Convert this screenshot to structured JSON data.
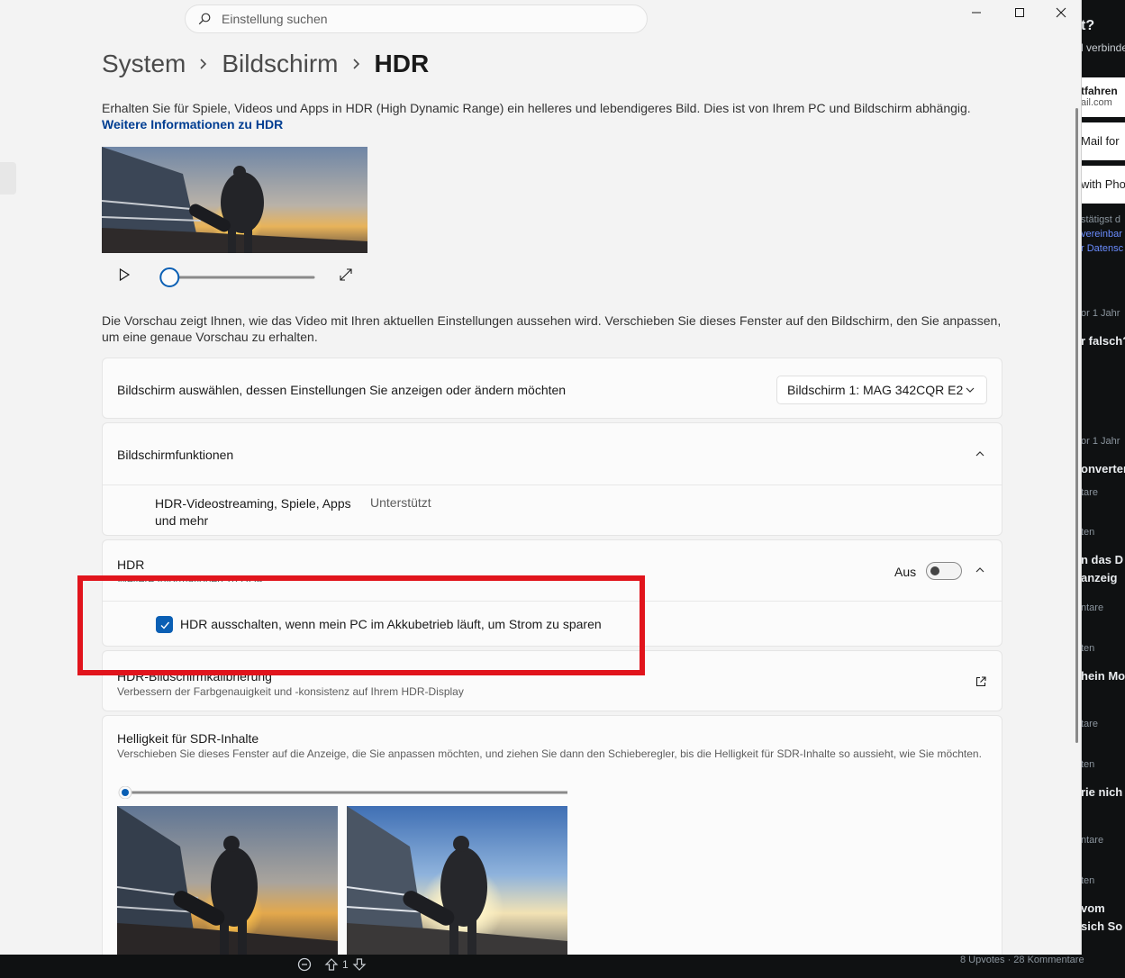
{
  "settings": {
    "search": {
      "placeholder": "Einstellung suchen"
    },
    "breadcrumb": {
      "items": [
        "System",
        "Bildschirm"
      ],
      "current": "HDR"
    },
    "intro": {
      "text": "Erhalten Sie für Spiele, Videos und Apps in HDR (High Dynamic Range) ein helleres und lebendigeres Bild. Dies ist von Ihrem PC und Bildschirm abhängig. ",
      "link": "Weitere Informationen zu HDR"
    },
    "preview_note": "Die Vorschau zeigt Ihnen, wie das Video mit Ihren aktuellen Einstellungen aussehen wird. Verschieben Sie dieses Fenster auf den Bildschirm, den Sie anpassen, um eine genaue Vorschau zu erhalten.",
    "player": {
      "progress": 0.02
    },
    "display_select": {
      "label": "Bildschirm auswählen, dessen Einstellungen Sie anzeigen oder ändern möchten",
      "value": "Bildschirm 1: MAG 342CQR E2"
    },
    "capabilities": {
      "title": "Bildschirmfunktionen",
      "feature": "HDR-Videostreaming, Spiele, Apps und mehr",
      "status": "Unterstützt"
    },
    "hdr": {
      "title": "HDR",
      "hidden_link": "Weitere Informationen zu HDR",
      "toggle_label": "Aus",
      "toggle_on": false,
      "battery_option": "HDR ausschalten, wenn mein PC im Akkubetrieb läuft, um Strom zu sparen",
      "battery_checked": true
    },
    "calibration": {
      "title": "HDR-Bildschirmkalibrierung",
      "subtitle": "Verbessern der Farbgenauigkeit und -konsistenz auf Ihrem HDR-Display"
    },
    "sdr": {
      "title": "Helligkeit für SDR-Inhalte",
      "subtitle": "Verschieben Sie dieses Fenster auf die Anzeige, die Sie anpassen möchten, und ziehen Sie dann den Schieberegler, bis die Helligkeit für SDR-Inhalte so aussieht, wie Sie möchten.",
      "slider_value": 0.0
    }
  },
  "background_page": {
    "fragments": [
      "t?",
      "l verbinde",
      "tfahren",
      "ail.com",
      "Mail for",
      "with Pho",
      "stätigst d",
      "vereinbar",
      "r Datensc",
      "or 1 Jahr",
      "r falsch?",
      "or 1 Jahr",
      "onverter",
      "tare",
      "ten",
      "n das D",
      "anzeig",
      "ntare",
      "ten",
      "hein Mo",
      "tare",
      "ten",
      "rie nich",
      "ntare",
      "ten",
      "vom",
      "sich So"
    ],
    "votes": "1",
    "meta": "8 Upvotes  ·  28 Kommentare"
  },
  "colors": {
    "accent": "#0a5fb4",
    "link": "#003e92",
    "annotation": "#e1141c"
  }
}
